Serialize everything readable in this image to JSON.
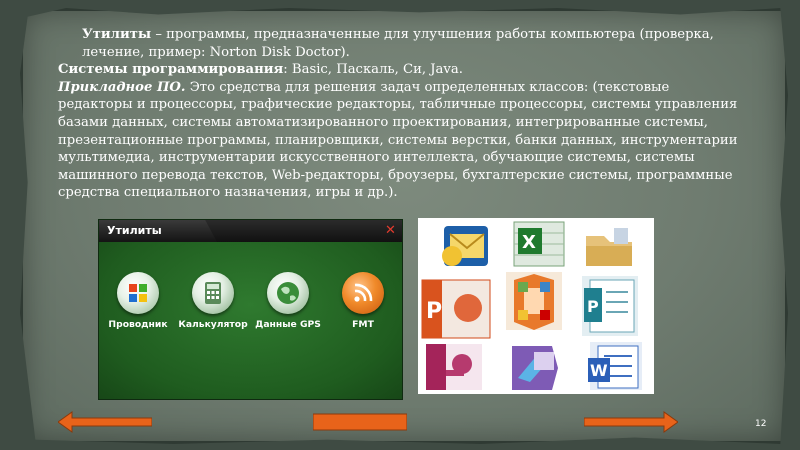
{
  "slide": {
    "number": "12"
  },
  "text": {
    "p1_term": "Утилиты",
    "p1_rest": " – программы, предназначенные для улучшения работы компьютера (проверка, лечение, пример: Norton Disk Doctor).",
    "p2_term": "Системы программирования",
    "p2_rest": ": Basic, Паскаль, Си, Java.",
    "p3_term": "Прикладное ПО.",
    "p3_rest": " Это средства для решения задач определенных классов: (текстовые редакторы и процессоры, графические редакторы, табличные процессоры, системы управления базами данных, системы автоматизированного проектирования, интегрированные системы, презентационные программы, планировщики, системы верстки, банки данных, инструментарии мультимедиа, инструментарии искусственного интеллекта, обучающие системы, системы машинного перевода текстов, Web-редакторы, броузеры, бухгалтерские системы, программные средства специального назначения, игры и др.)."
  },
  "utilities_window": {
    "title": "Утилиты",
    "close": "✕",
    "apps": [
      {
        "label": "Проводник",
        "icon": "windows-logo-icon",
        "color": "#e03a20"
      },
      {
        "label": "Калькулятор",
        "icon": "calculator-icon",
        "color": "#3f9a3f"
      },
      {
        "label": "Данные GPS",
        "icon": "globe-icon",
        "color": "#3c8a3c"
      },
      {
        "label": "FMT",
        "icon": "rss-icon",
        "color": "#e86a18"
      }
    ]
  },
  "office_icons": [
    "outlook-icon",
    "excel-icon",
    "folder-icon",
    "powerpoint-icon",
    "office-logo-icon",
    "publisher-icon",
    "access-icon",
    "infopath-icon",
    "word-icon"
  ],
  "nav": {
    "back_color": "#e8631a",
    "home_color": "#e8631a",
    "forward_color": "#e8631a"
  }
}
